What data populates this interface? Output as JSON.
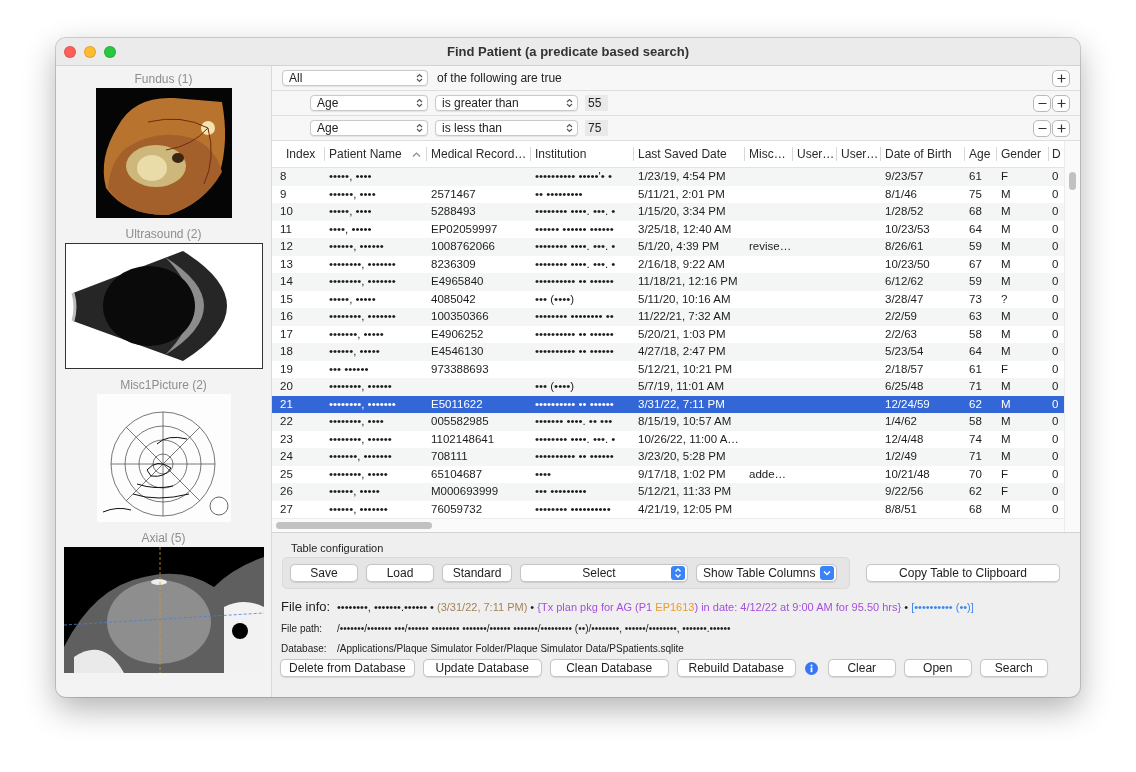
{
  "window": {
    "title": "Find Patient (a predicate based search)"
  },
  "image_panels": [
    {
      "label": "Fundus (1)",
      "kind": "fundus"
    },
    {
      "label": "Ultrasound (2)",
      "kind": "ultrasound"
    },
    {
      "label": "Misc1Picture (2)",
      "kind": "sketch"
    },
    {
      "label": "Axial (5)",
      "kind": "scan"
    }
  ],
  "predicate": {
    "quantifier": "All",
    "text": "of the following are true",
    "rules": [
      {
        "field": "Age",
        "operator": "is greater than",
        "value": "55"
      },
      {
        "field": "Age",
        "operator": "is less than",
        "value": "75"
      }
    ]
  },
  "table": {
    "columns": [
      {
        "label": "Index",
        "sorted": false
      },
      {
        "label": "Patient Name",
        "sorted": true
      },
      {
        "label": "Medical Record…",
        "sorted": false
      },
      {
        "label": "Institution",
        "sorted": false
      },
      {
        "label": "Last Saved Date",
        "sorted": false
      },
      {
        "label": "Misc…",
        "sorted": false
      },
      {
        "label": "User…",
        "sorted": false
      },
      {
        "label": "User…",
        "sorted": false
      },
      {
        "label": "Date of Birth",
        "sorted": false
      },
      {
        "label": "Age",
        "sorted": false
      },
      {
        "label": "Gender",
        "sorted": false
      },
      {
        "label": "D",
        "sorted": false
      }
    ],
    "rows": [
      {
        "selected": false,
        "cells": [
          "8",
          "•••••, ••••",
          null,
          "•••••••••• •••••'• •",
          "1/23/19, 4:54 PM",
          null,
          null,
          null,
          "9/23/57",
          "61",
          "F",
          "0"
        ]
      },
      {
        "selected": false,
        "cells": [
          "9",
          "••••••, ••••",
          "2571467",
          "•• •••••••••",
          "5/11/21, 2:01 PM",
          null,
          null,
          null,
          "8/1/46",
          "75",
          "M",
          "0"
        ]
      },
      {
        "selected": false,
        "cells": [
          "10",
          "•••••, ••••",
          "5288493",
          "•••••••• ••••. •••. •",
          "1/15/20, 3:34 PM",
          null,
          null,
          null,
          "1/28/52",
          "68",
          "M",
          "0"
        ]
      },
      {
        "selected": false,
        "cells": [
          "11",
          "••••, •••••",
          "EP02059997",
          "•••••• •••••• ••••••",
          "3/25/18, 12:40 AM",
          null,
          null,
          null,
          "10/23/53",
          "64",
          "M",
          "0"
        ]
      },
      {
        "selected": false,
        "cells": [
          "12",
          "••••••, ••••••",
          "1008762066",
          "•••••••• ••••. •••. •",
          "5/1/20, 4:39 PM",
          "revise…",
          null,
          null,
          "8/26/61",
          "59",
          "M",
          "0"
        ]
      },
      {
        "selected": false,
        "cells": [
          "13",
          "••••••••, •••••••",
          "8236309",
          "•••••••• ••••. •••. •",
          "2/16/18, 9:22 AM",
          null,
          null,
          null,
          "10/23/50",
          "67",
          "M",
          "0"
        ]
      },
      {
        "selected": false,
        "cells": [
          "14",
          "••••••••, •••••••",
          "E4965840",
          "•••••••••• •• ••••••",
          "11/18/21, 12:16 PM",
          null,
          null,
          null,
          "6/12/62",
          "59",
          "M",
          "0"
        ]
      },
      {
        "selected": false,
        "cells": [
          "15",
          "•••••, •••••",
          "4085042",
          "••• (••••)",
          "5/11/20, 10:16 AM",
          null,
          null,
          null,
          "3/28/47",
          "73",
          "?",
          "0"
        ]
      },
      {
        "selected": false,
        "cells": [
          "16",
          "••••••••, •••••••",
          "100350366",
          "•••••••• •••••••• ••",
          "11/22/21, 7:32 AM",
          null,
          null,
          null,
          "2/2/59",
          "63",
          "M",
          "0"
        ]
      },
      {
        "selected": false,
        "cells": [
          "17",
          "•••••••, •••••",
          "E4906252",
          "•••••••••• •• ••••••",
          "5/20/21, 1:03 PM",
          null,
          null,
          null,
          "2/2/63",
          "58",
          "M",
          "0"
        ]
      },
      {
        "selected": false,
        "cells": [
          "18",
          "••••••, •••••",
          "E4546130",
          "•••••••••• •• ••••••",
          "4/27/18, 2:47 PM",
          null,
          null,
          null,
          "5/23/54",
          "64",
          "M",
          "0"
        ]
      },
      {
        "selected": false,
        "cells": [
          "19",
          "••• ••••••",
          "973388693",
          null,
          "5/12/21, 10:21 PM",
          null,
          null,
          null,
          "2/18/57",
          "61",
          "F",
          "0"
        ]
      },
      {
        "selected": false,
        "cells": [
          "20",
          "••••••••, ••••••",
          null,
          "••• (••••)",
          "5/7/19, 11:01 AM",
          null,
          null,
          null,
          "6/25/48",
          "71",
          "M",
          "0"
        ]
      },
      {
        "selected": true,
        "cells": [
          "21",
          "••••••••, •••••••",
          "E5011622",
          "•••••••••• •• ••••••",
          "3/31/22, 7:11 PM",
          null,
          null,
          null,
          "12/24/59",
          "62",
          "M",
          "0"
        ]
      },
      {
        "selected": false,
        "cells": [
          "22",
          "••••••••, ••••",
          "005582985",
          "••••••• ••••. •• •••",
          "8/15/19, 10:57 AM",
          null,
          null,
          null,
          "1/4/62",
          "58",
          "M",
          "0"
        ]
      },
      {
        "selected": false,
        "cells": [
          "23",
          "••••••••, ••••••",
          "1102148641",
          "•••••••• ••••. •••. •",
          "10/26/22, 11:00 A…",
          null,
          null,
          null,
          "12/4/48",
          "74",
          "M",
          "0"
        ]
      },
      {
        "selected": false,
        "cells": [
          "24",
          "•••••••, •••••••",
          "708111",
          "•••••••••• •• ••••••",
          "3/23/20, 5:28 PM",
          null,
          null,
          null,
          "1/2/49",
          "71",
          "M",
          "0"
        ]
      },
      {
        "selected": false,
        "cells": [
          "25",
          "••••••••, •••••",
          "65104687",
          "••••",
          "9/17/18, 1:02 PM",
          "adde…",
          null,
          null,
          "10/21/48",
          "70",
          "F",
          "0"
        ]
      },
      {
        "selected": false,
        "cells": [
          "26",
          "••••••, •••••",
          "M000693999",
          "••• •••••••••",
          "5/12/21, 11:33 PM",
          null,
          null,
          null,
          "9/22/56",
          "62",
          "F",
          "0"
        ]
      },
      {
        "selected": false,
        "cells": [
          "27",
          "••••••, •••••••",
          "76059732",
          "•••••••• ••••••••••",
          "4/21/19, 12:05 PM",
          null,
          null,
          null,
          "8/8/51",
          "68",
          "M",
          "0"
        ]
      }
    ]
  },
  "table_configuration": {
    "title": "Table configuration",
    "buttons": [
      "Save",
      "Load",
      "Standard"
    ],
    "popups": [
      {
        "label": "Select",
        "kind": "popup"
      },
      {
        "label": "Show Table Columns",
        "kind": "pulldown"
      }
    ],
    "copy_button": "Copy Table to Clipboard"
  },
  "file_info": {
    "label": "File info:",
    "parts": [
      {
        "text": "••••••••, •••••••.••••••",
        "color": "#1d1d1f"
      },
      {
        "text": " • "
      },
      {
        "text": "(3/31/22, 7:11 PM)",
        "color": "#a3845a"
      },
      {
        "text": " • "
      },
      {
        "text": "{Tx plan pkg for AG (P1 ",
        "color": "#a54fdc"
      },
      {
        "text": "EP1613",
        "color": "#ee9a25"
      },
      {
        "text": ") in date: 4/12/22 at 9:00 AM for 95.50 hrs}",
        "color": "#a54fdc"
      },
      {
        "text": " • "
      },
      {
        "text": "[•••••••••• (••)]",
        "color": "#3a86f2"
      }
    ]
  },
  "file_path": {
    "label": "File path:",
    "value": "/•••••••/••••••• •••/•••••• •••••••• •••••••/•••••• •••••••/••••••••• (••)/••••••••, ••••••/••••••••, •••••••.••••••"
  },
  "database": {
    "label": "Database:",
    "value": "/Applications/Plaque Simulator Folder/Plaque Simulator Data/PSpatients.sqlite"
  },
  "actions": {
    "database_buttons": [
      "Delete from Database",
      "Update Database",
      "Clean Database",
      "Rebuild Database"
    ],
    "buttons": [
      "Clear",
      "Open",
      "Search"
    ]
  }
}
